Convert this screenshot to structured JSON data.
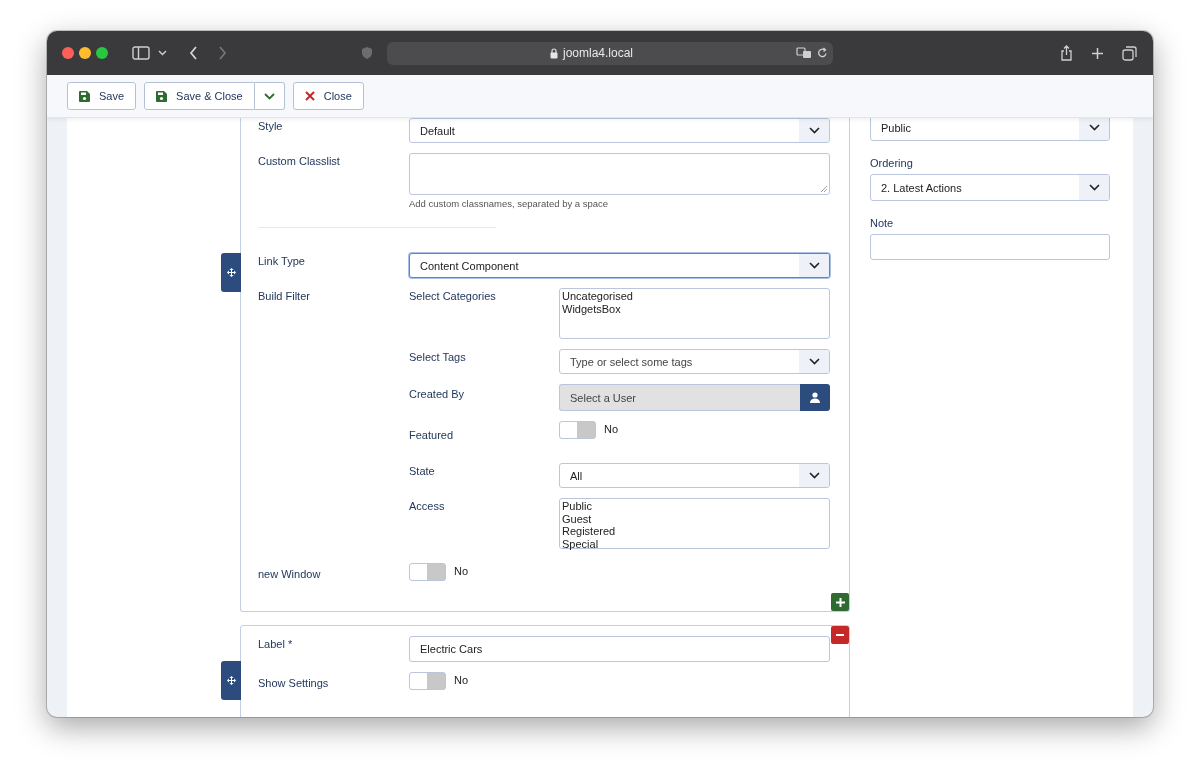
{
  "browser": {
    "url": "joomla4.local"
  },
  "toolbar": [
    {
      "kind": "save",
      "label": "Save"
    },
    {
      "kind": "save",
      "label": "Save & Close"
    },
    {
      "kind": "dropdown"
    },
    {
      "kind": "close",
      "label": "Close"
    }
  ],
  "items": [
    {
      "fields": [
        {
          "kind": "select",
          "label": "Style",
          "value": "Default",
          "focused": false
        },
        {
          "kind": "textarea",
          "label": "Custom Classlist",
          "hint": "Add custom classnames, separated by a space"
        },
        {
          "kind": "divider"
        },
        {
          "kind": "select",
          "label": "Link Type",
          "value": "Content Component",
          "focused": true
        },
        {
          "kind": "group",
          "label": "Build Filter",
          "children": [
            {
              "kind": "listbox",
              "label": "Select Categories",
              "options": [
                "Uncategorised",
                "WidgetsBox"
              ]
            },
            {
              "kind": "tags",
              "label": "Select Tags",
              "placeholder": "Type or select some tags"
            },
            {
              "kind": "user",
              "label": "Created By",
              "placeholder": "Select a User"
            },
            {
              "kind": "toggle",
              "label": "Featured",
              "on": false,
              "text": "No"
            },
            {
              "kind": "select",
              "label": "State",
              "value": "All",
              "focused": false
            },
            {
              "kind": "listbox",
              "label": "Access",
              "options": [
                "Public",
                "Guest",
                "Registered",
                "Special"
              ]
            }
          ]
        },
        {
          "kind": "toggle",
          "label": "new Window",
          "on": false,
          "text": "No"
        }
      ]
    },
    {
      "fields": [
        {
          "kind": "text",
          "label": "Label *",
          "value": "Electric Cars"
        },
        {
          "kind": "toggle",
          "label": "Show Settings",
          "on": false,
          "text": "No"
        }
      ]
    }
  ],
  "sidebar": [
    {
      "kind": "select",
      "value": "Public",
      "focused": false
    },
    {
      "kind": "select",
      "label": "Ordering",
      "value": "2. Latest Actions",
      "focused": false
    },
    {
      "kind": "text",
      "label": "Note"
    }
  ]
}
